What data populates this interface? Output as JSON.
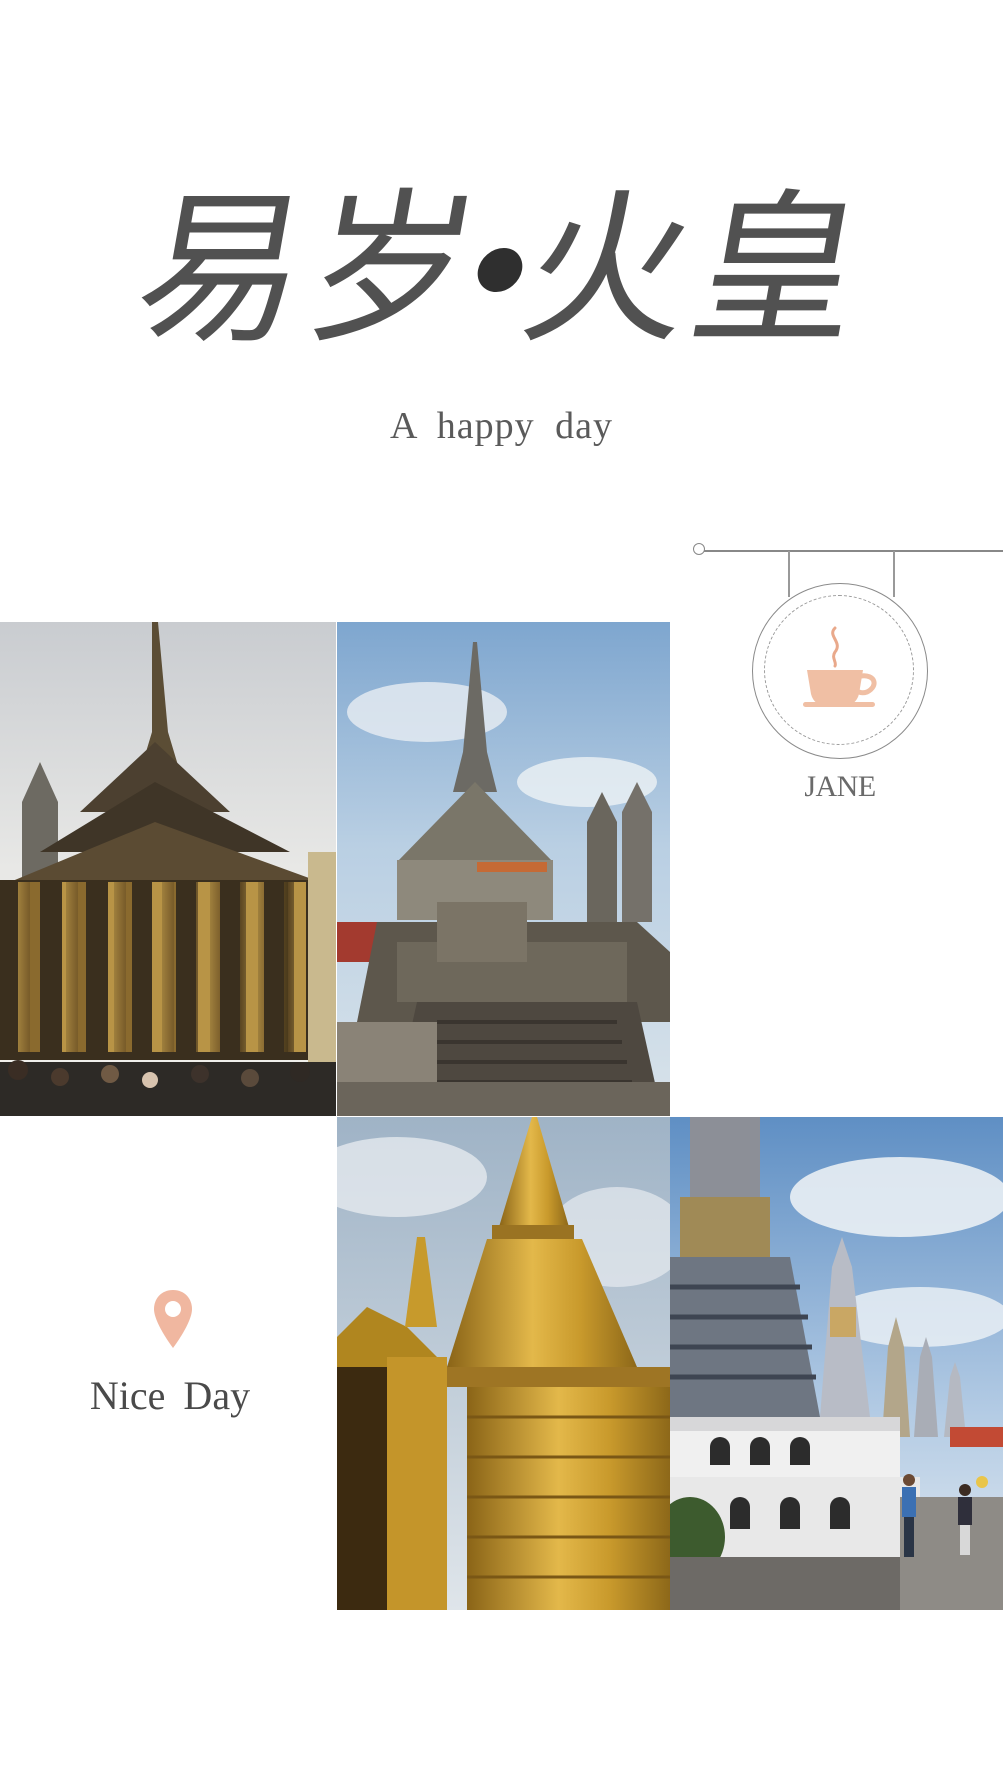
{
  "title": {
    "chars": [
      "易",
      "岁",
      "火",
      "皇"
    ]
  },
  "subtitle": "A happy day",
  "badge": {
    "icon": "coffee-cup-icon",
    "label": "JANE",
    "accent": "#e9a98b"
  },
  "location": {
    "icon": "map-pin-icon",
    "label": "Nice Day",
    "accent": "#e9a98b"
  },
  "photos": [
    {
      "subject": "temple-golden-columns-photo"
    },
    {
      "subject": "temple-stone-model-photo"
    },
    {
      "subject": "golden-chedi-photo"
    },
    {
      "subject": "white-prang-towers-photo"
    }
  ],
  "colors": {
    "background": "#ffffff",
    "title_ink": "#3f3f3f",
    "text_gray": "#5a5a5a"
  }
}
